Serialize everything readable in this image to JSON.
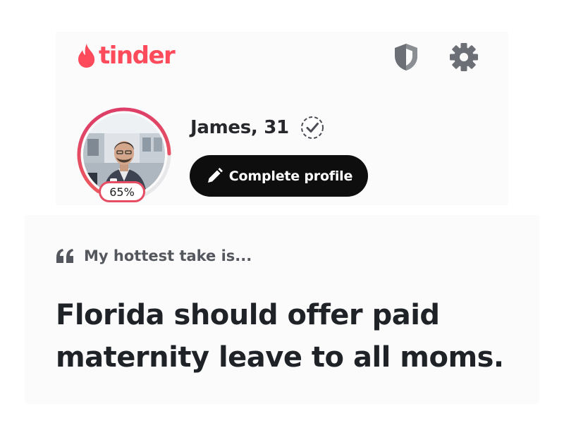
{
  "app": {
    "logo_text": "tinder",
    "brand_color": "#fd4b5c"
  },
  "header": {
    "icons": [
      "shield-icon",
      "gear-icon"
    ]
  },
  "profile": {
    "name_age": "James, 31",
    "completion_text": "65%",
    "completion_fraction": 0.65,
    "verified": true,
    "complete_button_label": "Complete profile",
    "ring_color_start": "#f3645b",
    "ring_color_end": "#d9386a"
  },
  "prompt": {
    "label": "My hottest take is...",
    "answer": "Florida should offer paid maternity leave to all moms."
  }
}
